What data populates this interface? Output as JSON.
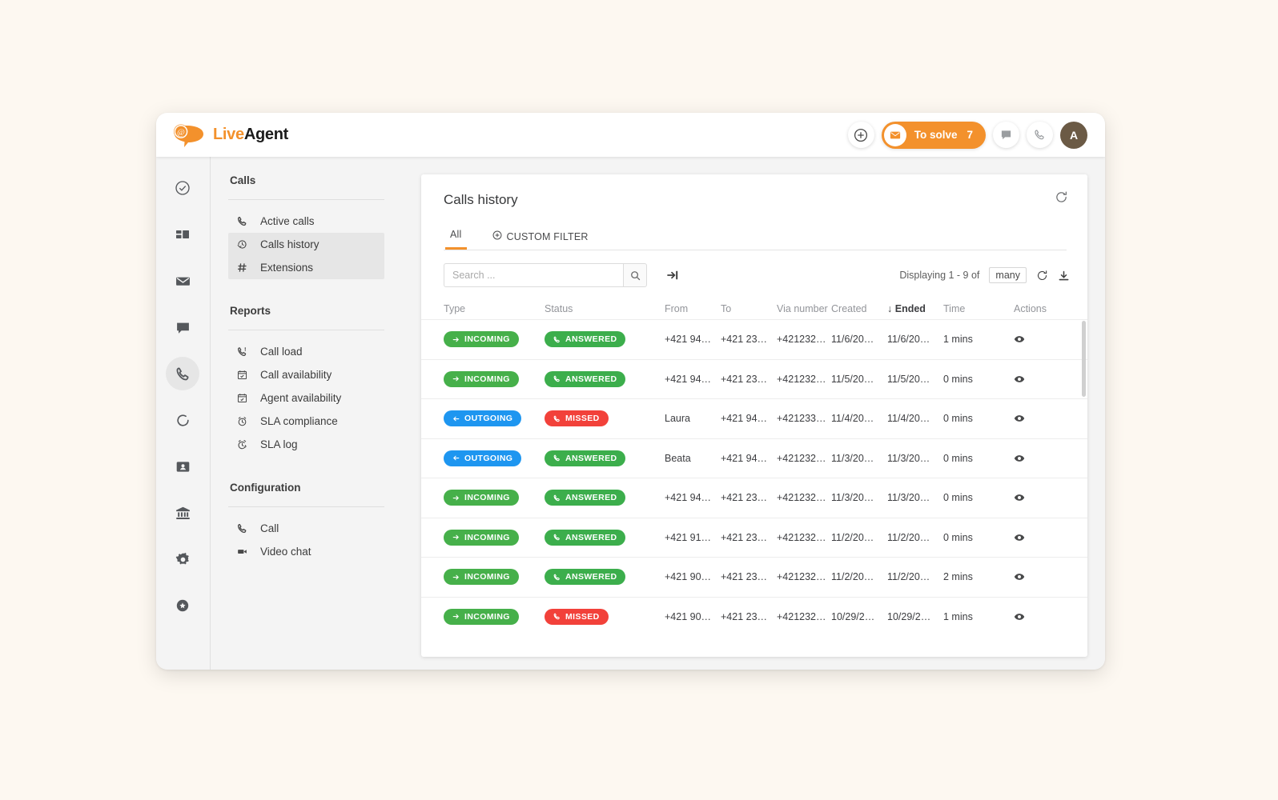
{
  "brand": {
    "live": "Live",
    "agent": "Agent",
    "logo_icon": "at-speech-bubble-icon"
  },
  "topbar": {
    "add_label": "plus-circle-icon",
    "to_solve_label": "To solve",
    "to_solve_count": "7",
    "chat_icon": "chat-icon",
    "call_icon": "phone-icon",
    "avatar_initial": "A",
    "accent_color": "#f3912c"
  },
  "rail": [
    {
      "name": "tickets",
      "icon": "check-circle-icon",
      "active": false
    },
    {
      "name": "dashboard",
      "icon": "dashboard-grid-icon",
      "active": false
    },
    {
      "name": "email",
      "icon": "envelope-icon",
      "active": false
    },
    {
      "name": "chat",
      "icon": "chat-bubble-icon",
      "active": false
    },
    {
      "name": "calls",
      "icon": "phone-icon",
      "active": true
    },
    {
      "name": "sync",
      "icon": "circle-dashed-icon",
      "active": false
    },
    {
      "name": "contacts",
      "icon": "contact-card-icon",
      "active": false
    },
    {
      "name": "bank",
      "icon": "bank-icon",
      "active": false
    },
    {
      "name": "settings",
      "icon": "gear-icon",
      "active": false
    },
    {
      "name": "support",
      "icon": "star-circle-icon",
      "active": false
    }
  ],
  "nav": {
    "sections": [
      {
        "title": "Calls",
        "items": [
          {
            "label": "Active calls",
            "icon": "phone-icon",
            "highlight": false
          },
          {
            "label": "Calls history",
            "icon": "history-clock-icon",
            "highlight": true
          },
          {
            "label": "Extensions",
            "icon": "hash-icon",
            "highlight": true
          }
        ]
      },
      {
        "title": "Reports",
        "items": [
          {
            "label": "Call load",
            "icon": "phone-load-icon",
            "highlight": false
          },
          {
            "label": "Call availability",
            "icon": "calendar-check-icon",
            "highlight": false
          },
          {
            "label": "Agent availability",
            "icon": "calendar-icon",
            "highlight": false
          },
          {
            "label": "SLA compliance",
            "icon": "alarm-clock-icon",
            "highlight": false
          },
          {
            "label": "SLA log",
            "icon": "alarm-log-icon",
            "highlight": false
          }
        ]
      },
      {
        "title": "Configuration",
        "items": [
          {
            "label": "Call",
            "icon": "phone-icon",
            "highlight": false
          },
          {
            "label": "Video chat",
            "icon": "video-camera-icon",
            "highlight": false
          }
        ]
      }
    ]
  },
  "card": {
    "title": "Calls history",
    "refresh_icon": "refresh-icon",
    "tabs": [
      {
        "label": "All",
        "icon": null,
        "active": true
      },
      {
        "label": "CUSTOM FILTER",
        "icon": "plus-circle-icon",
        "active": false
      }
    ]
  },
  "toolbar": {
    "search_placeholder": "Search ...",
    "search_value": "",
    "search_icon": "magnifier-icon",
    "forward_icon": "arrow-to-end-icon",
    "displaying_text": "Displaying 1 - 9 of",
    "page_size": "many",
    "refresh_icon": "refresh-icon",
    "export_icon": "export-download-icon"
  },
  "table": {
    "columns": [
      "Type",
      "Status",
      "From",
      "To",
      "Via number",
      "Created",
      "Ended",
      "Time",
      "Actions"
    ],
    "sort_column": "Ended",
    "sort_arrow": "↓",
    "rows": [
      {
        "type": "INCOMING",
        "type_kind": "incoming",
        "status": "ANSWERED",
        "status_kind": "answered",
        "from": "+421 94…",
        "to": "+421 23…",
        "via": "+421232…",
        "created": "11/6/20…",
        "ended": "11/6/20…",
        "time": "1 mins",
        "action_icon": "eye-icon"
      },
      {
        "type": "INCOMING",
        "type_kind": "incoming",
        "status": "ANSWERED",
        "status_kind": "answered",
        "from": "+421 94…",
        "to": "+421 23…",
        "via": "+421232…",
        "created": "11/5/20…",
        "ended": "11/5/20…",
        "time": "0 mins",
        "action_icon": "eye-icon"
      },
      {
        "type": "OUTGOING",
        "type_kind": "outgoing",
        "status": "MISSED",
        "status_kind": "missed",
        "from": "Laura",
        "to": "+421 94…",
        "via": "+421233…",
        "created": "11/4/20…",
        "ended": "11/4/20…",
        "time": "0 mins",
        "action_icon": "eye-icon"
      },
      {
        "type": "OUTGOING",
        "type_kind": "outgoing",
        "status": "ANSWERED",
        "status_kind": "answered",
        "from": "Beata",
        "to": "+421 94…",
        "via": "+421232…",
        "created": "11/3/20…",
        "ended": "11/3/20…",
        "time": "0 mins",
        "action_icon": "eye-icon"
      },
      {
        "type": "INCOMING",
        "type_kind": "incoming",
        "status": "ANSWERED",
        "status_kind": "answered",
        "from": "+421 94…",
        "to": "+421 23…",
        "via": "+421232…",
        "created": "11/3/20…",
        "ended": "11/3/20…",
        "time": "0 mins",
        "action_icon": "eye-icon"
      },
      {
        "type": "INCOMING",
        "type_kind": "incoming",
        "status": "ANSWERED",
        "status_kind": "answered",
        "from": "+421 91…",
        "to": "+421 23…",
        "via": "+421232…",
        "created": "11/2/20…",
        "ended": "11/2/20…",
        "time": "0 mins",
        "action_icon": "eye-icon"
      },
      {
        "type": "INCOMING",
        "type_kind": "incoming",
        "status": "ANSWERED",
        "status_kind": "answered",
        "from": "+421 90…",
        "to": "+421 23…",
        "via": "+421232…",
        "created": "11/2/20…",
        "ended": "11/2/20…",
        "time": "2 mins",
        "action_icon": "eye-icon"
      },
      {
        "type": "INCOMING",
        "type_kind": "incoming",
        "status": "MISSED",
        "status_kind": "missed",
        "from": "+421 90…",
        "to": "+421 23…",
        "via": "+421232…",
        "created": "10/29/2…",
        "ended": "10/29/2…",
        "time": "1 mins",
        "action_icon": "eye-icon"
      }
    ]
  },
  "colors": {
    "accent": "#f3912c",
    "green": "#46b04a",
    "blue": "#1e96f0",
    "red": "#f2413a",
    "page_bg": "#fdf8f1"
  }
}
